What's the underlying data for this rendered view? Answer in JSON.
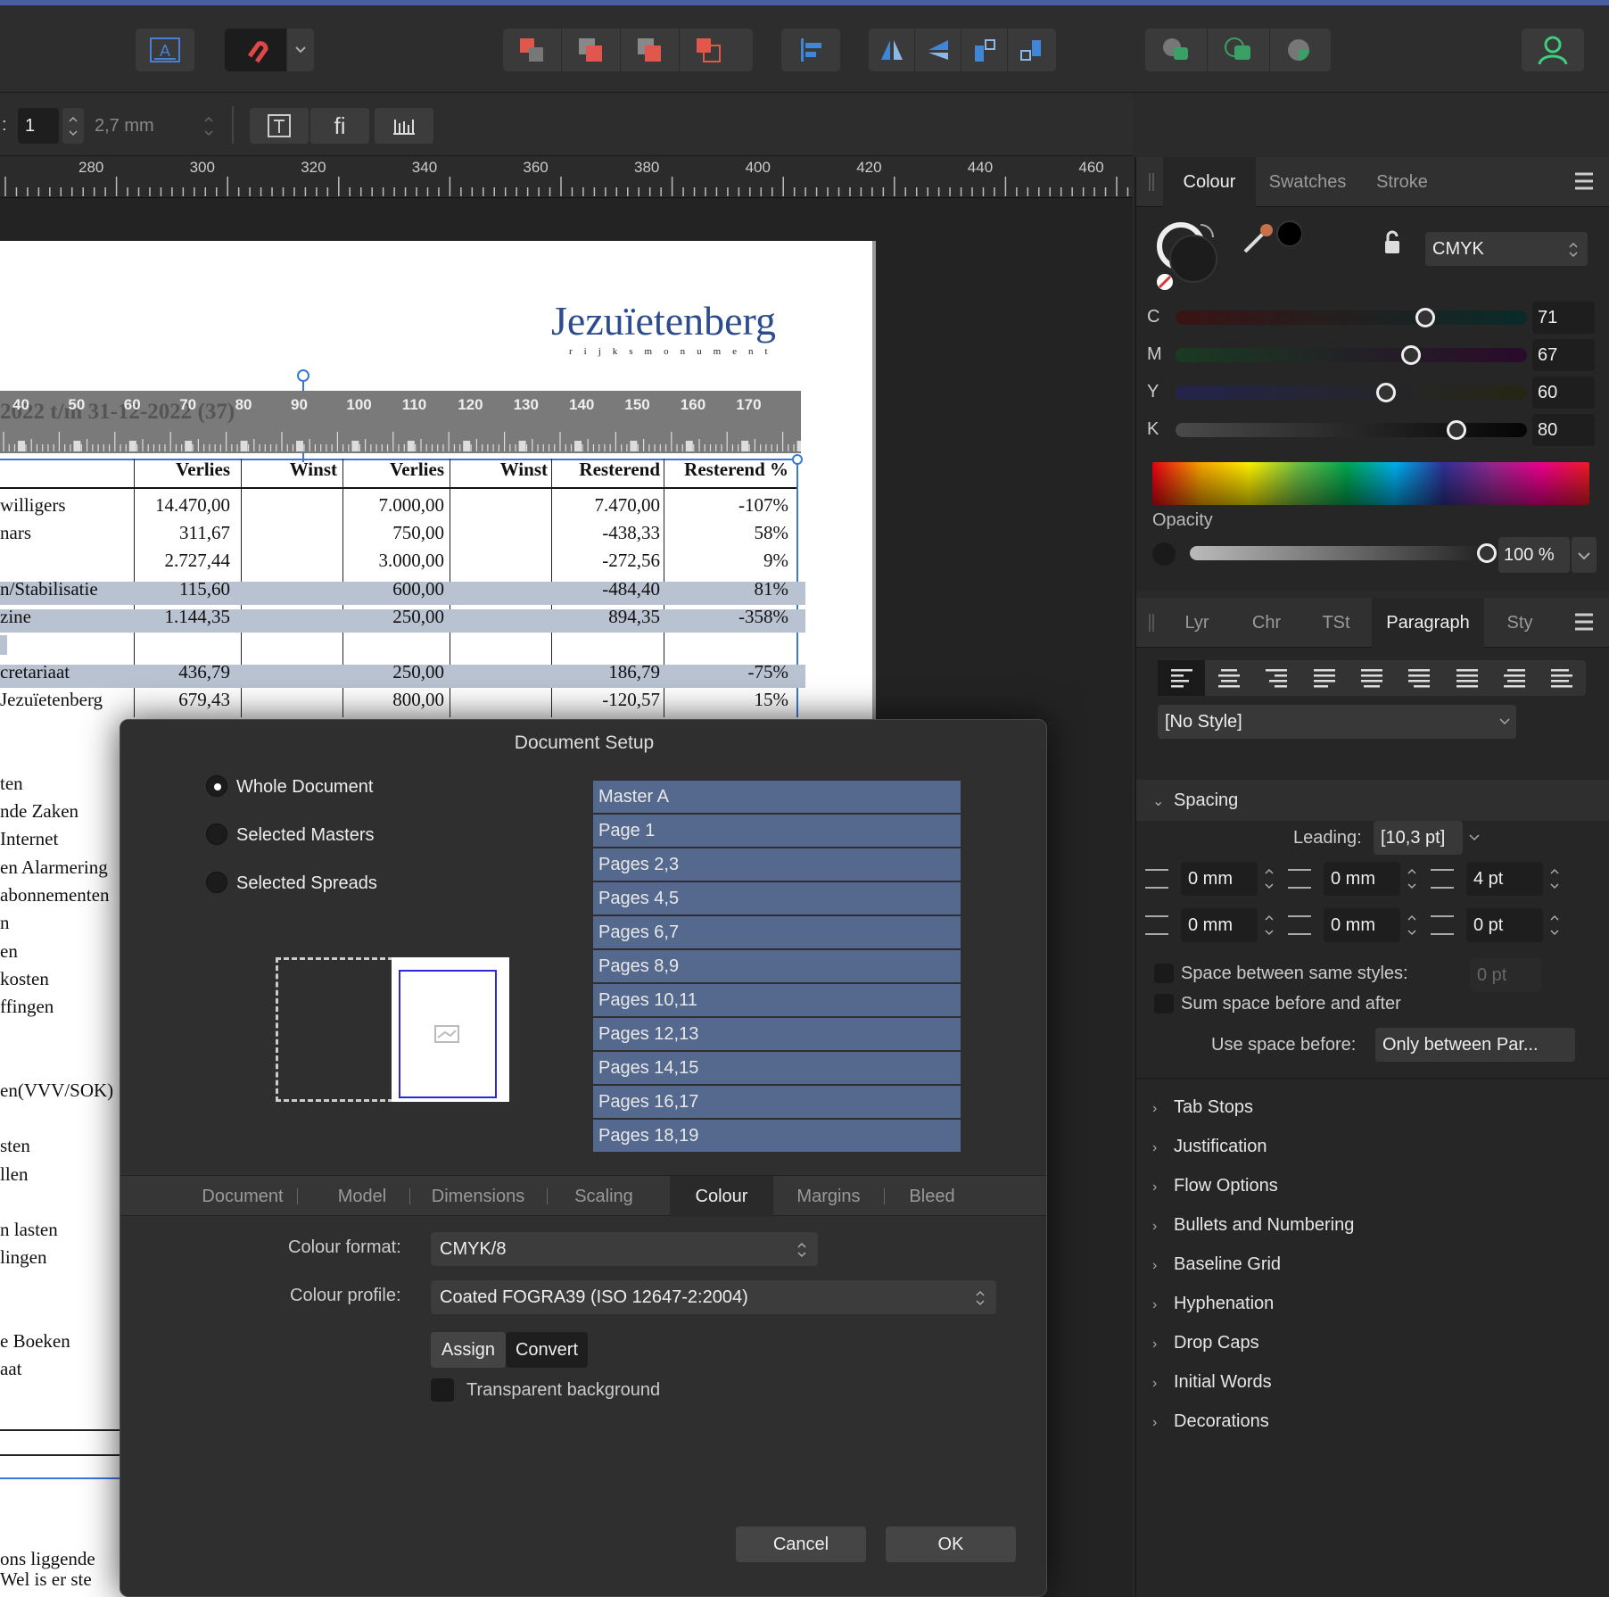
{
  "toolbar": {
    "icons": [
      "text-frame-icon",
      "snapping-magnet-icon",
      "arrange-back-icon",
      "arrange-backward-icon",
      "arrange-forward-icon",
      "arrange-front-icon",
      "align-left-icon",
      "flip-horizontal-icon",
      "flip-vertical-icon",
      "rotate-left-icon",
      "rotate-right-icon",
      "boolean-add-icon",
      "boolean-intersect-icon",
      "boolean-subtract-icon",
      "user-icon"
    ]
  },
  "context_bar": {
    "prefix": ":",
    "value": "1",
    "size": "2,7 mm",
    "fi_label": "fi"
  },
  "ruler": {
    "ticks": [
      "280",
      "300",
      "320",
      "340",
      "360",
      "380",
      "400",
      "420",
      "440",
      "460"
    ]
  },
  "document": {
    "logo": "Jezuïetenberg",
    "logo_sub": "rijksmonument",
    "table_ruler": [
      "40",
      "50",
      "60",
      "70",
      "80",
      "90",
      "100",
      "110",
      "120",
      "130",
      "140",
      "150",
      "160",
      "170"
    ],
    "table_title": "2022 t/m 31-12-2022 (37)",
    "headers": [
      "Verlies",
      "Winst",
      "Verlies",
      "Winst",
      "Resterend",
      "Resterend %"
    ],
    "rows": [
      {
        "label": "willigers",
        "c1": "14.470,00",
        "c3": "7.000,00",
        "c5": "7.470,00",
        "c6": "-107%",
        "hl": false
      },
      {
        "label": "nars",
        "c1": "311,67",
        "c3": "750,00",
        "c5": "-438,33",
        "c6": "58%",
        "hl": false
      },
      {
        "label": "",
        "c1": "2.727,44",
        "c3": "3.000,00",
        "c5": "-272,56",
        "c6": "9%",
        "hl": false
      },
      {
        "label": "n/Stabilisatie",
        "c1": "115,60",
        "c3": "600,00",
        "c5": "-484,40",
        "c6": "81%",
        "hl": true
      },
      {
        "label": "zine",
        "c1": "1.144,35",
        "c3": "250,00",
        "c5": "894,35",
        "c6": "-358%",
        "hl": true
      },
      {
        "label": "",
        "c1": "",
        "c3": "",
        "c5": "",
        "c6": "",
        "hl": false
      },
      {
        "label": "cretariaat",
        "c1": "436,79",
        "c3": "250,00",
        "c5": "186,79",
        "c6": "-75%",
        "hl": true
      },
      {
        "label": "Jezuïetenberg",
        "c1": "679,43",
        "c3": "800,00",
        "c5": "-120,57",
        "c6": "15%",
        "hl": false
      }
    ],
    "left_labels": [
      "ten",
      "nde Zaken",
      "Internet",
      "en Alarmering",
      "abonnementen",
      "n",
      "en",
      "kosten",
      "ffingen",
      "en(VVV/SOK)",
      "sten",
      "llen",
      "n lasten",
      "lingen",
      "e Boeken",
      "aat",
      "ons liggende",
      "Wel is er ste"
    ]
  },
  "colour_panel": {
    "tabs": [
      "Colour",
      "Swatches",
      "Stroke"
    ],
    "model": "CMYK",
    "channels": [
      {
        "label": "C",
        "value": "71"
      },
      {
        "label": "M",
        "value": "67"
      },
      {
        "label": "Y",
        "value": "60"
      },
      {
        "label": "K",
        "value": "80"
      }
    ],
    "opacity_label": "Opacity",
    "opacity_value": "100 %"
  },
  "paragraph_panel": {
    "tabs": [
      "Lyr",
      "Chr",
      "TSt",
      "Paragraph",
      "Sty"
    ],
    "style": "[No Style]",
    "spacing_label": "Spacing",
    "leading_label": "Leading:",
    "leading_value": "[10,3 pt]",
    "indent_left": "0 mm",
    "indent_first": "0 mm",
    "space_before": "4 pt",
    "indent_right": "0 mm",
    "indent_last": "0 mm",
    "space_after": "0 pt",
    "same_styles_label": "Space between same styles:",
    "same_styles_value": "0 pt",
    "sum_space_label": "Sum space before and after",
    "use_space_label": "Use space before:",
    "use_space_value": "Only between Par...",
    "sections": [
      "Tab Stops",
      "Justification",
      "Flow Options",
      "Bullets and Numbering",
      "Baseline Grid",
      "Hyphenation",
      "Drop Caps",
      "Initial Words",
      "Decorations"
    ]
  },
  "dialog": {
    "title": "Document Setup",
    "radios": [
      "Whole Document",
      "Selected Masters",
      "Selected Spreads"
    ],
    "spreads": [
      "Master A",
      "Page 1",
      "Pages 2,3",
      "Pages 4,5",
      "Pages 6,7",
      "Pages 8,9",
      "Pages 10,11",
      "Pages 12,13",
      "Pages 14,15",
      "Pages 16,17",
      "Pages 18,19"
    ],
    "tabs": [
      "Document",
      "Model",
      "Dimensions",
      "Scaling",
      "Colour",
      "Margins",
      "Bleed"
    ],
    "colour_format_label": "Colour format:",
    "colour_format": "CMYK/8",
    "colour_profile_label": "Colour profile:",
    "colour_profile": "Coated FOGRA39 (ISO 12647-2:2004)",
    "assign": "Assign",
    "convert": "Convert",
    "transparent_label": "Transparent background",
    "cancel": "Cancel",
    "ok": "OK"
  }
}
